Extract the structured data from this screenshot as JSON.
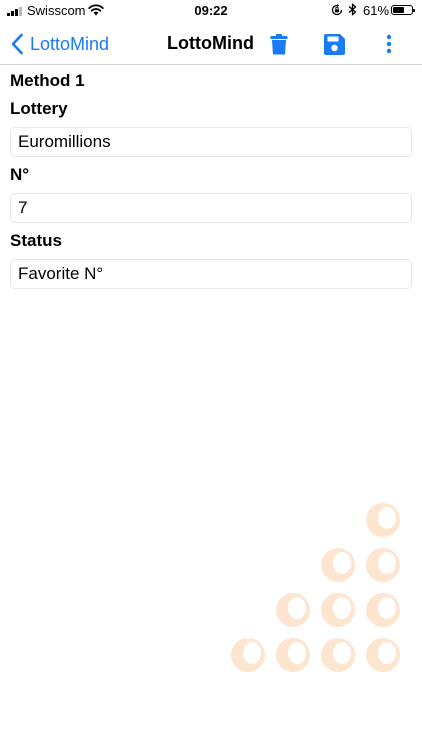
{
  "status_bar": {
    "carrier": "Swisscom",
    "time": "09:22",
    "battery_percent": "61%",
    "battery_level": 0.61,
    "icons": [
      "signal-bars-icon",
      "wifi-icon",
      "rotation-lock-icon",
      "bluetooth-icon",
      "battery-icon"
    ]
  },
  "nav": {
    "back_label": "LottoMind",
    "title": "LottoMind",
    "actions": [
      "trash-icon",
      "save-icon",
      "more-vertical-icon"
    ],
    "accent_color": "#1a7cf3"
  },
  "form": {
    "section_title": "Method 1",
    "fields": [
      {
        "label": "Lottery",
        "value": "Euromillions"
      },
      {
        "label": "N°",
        "value": "7"
      },
      {
        "label": "Status",
        "value": "Favorite N°"
      }
    ]
  },
  "decoration": {
    "logo_color": "#fde5cf"
  }
}
